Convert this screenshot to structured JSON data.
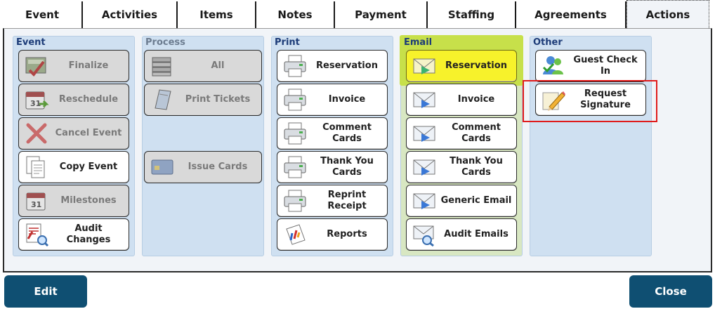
{
  "tabs": [
    {
      "label": "Event"
    },
    {
      "label": "Activities"
    },
    {
      "label": "Items"
    },
    {
      "label": "Notes"
    },
    {
      "label": "Payment"
    },
    {
      "label": "Staffing"
    },
    {
      "label": "Agreements"
    },
    {
      "label": "Actions",
      "active": true
    }
  ],
  "groups": {
    "event": {
      "title": "Event",
      "buttons": [
        {
          "label": "Finalize",
          "icon": "finalize-icon",
          "disabled": true
        },
        {
          "label": "Reschedule",
          "icon": "calendar-icon",
          "disabled": true
        },
        {
          "label": "Cancel Event",
          "icon": "cancel-x-icon",
          "disabled": true
        },
        {
          "label": "Copy Event",
          "icon": "copy-documents-icon",
          "disabled": false
        },
        {
          "label": "Milestones",
          "icon": "calendar-icon",
          "disabled": true
        },
        {
          "label": "Audit Changes",
          "icon": "audit-changes-icon",
          "disabled": false
        }
      ]
    },
    "process": {
      "title": "Process",
      "buttons": [
        {
          "label": "All",
          "icon": "stack-papers-icon",
          "disabled": true
        },
        {
          "label": "Print Tickets",
          "icon": "ticket-book-icon",
          "disabled": true
        },
        {
          "label": "Issue Cards",
          "icon": "smart-card-icon",
          "disabled": true
        }
      ]
    },
    "print": {
      "title": "Print",
      "buttons": [
        {
          "label": "Reservation",
          "icon": "printer-icon"
        },
        {
          "label": "Invoice",
          "icon": "printer-icon"
        },
        {
          "label": "Comment Cards",
          "icon": "printer-icon"
        },
        {
          "label": "Thank You Cards",
          "icon": "printer-icon"
        },
        {
          "label": "Reprint Receipt",
          "icon": "printer-icon"
        },
        {
          "label": "Reports",
          "icon": "reports-chart-icon"
        }
      ]
    },
    "email": {
      "title": "Email",
      "buttons": [
        {
          "label": "Reservation",
          "icon": "envelope-send-icon",
          "highlighted": true
        },
        {
          "label": "Invoice",
          "icon": "envelope-send-icon"
        },
        {
          "label": "Comment Cards",
          "icon": "envelope-send-icon"
        },
        {
          "label": "Thank You Cards",
          "icon": "envelope-send-icon"
        },
        {
          "label": "Generic Email",
          "icon": "envelope-send-icon"
        },
        {
          "label": "Audit Emails",
          "icon": "envelope-search-icon"
        }
      ]
    },
    "other": {
      "title": "Other",
      "buttons": [
        {
          "label": "Guest Check In",
          "icon": "users-check-icon"
        },
        {
          "label": "Request\nSignature",
          "icon": "pencil-signature-icon",
          "boxed": true
        }
      ]
    }
  },
  "footer": {
    "edit_label": "Edit",
    "close_label": "Close"
  },
  "colors": {
    "panel_bg": "#f1f4f8",
    "group_bg": "#cfe0f1",
    "email_group_bg": "#d8e7c2",
    "email_highlight": "#c7e04a",
    "highlight_button": "#f7f22b",
    "footer_button": "#0f4f72",
    "group_title": "#1d3c78",
    "annotation_box": "#e01b1b"
  }
}
